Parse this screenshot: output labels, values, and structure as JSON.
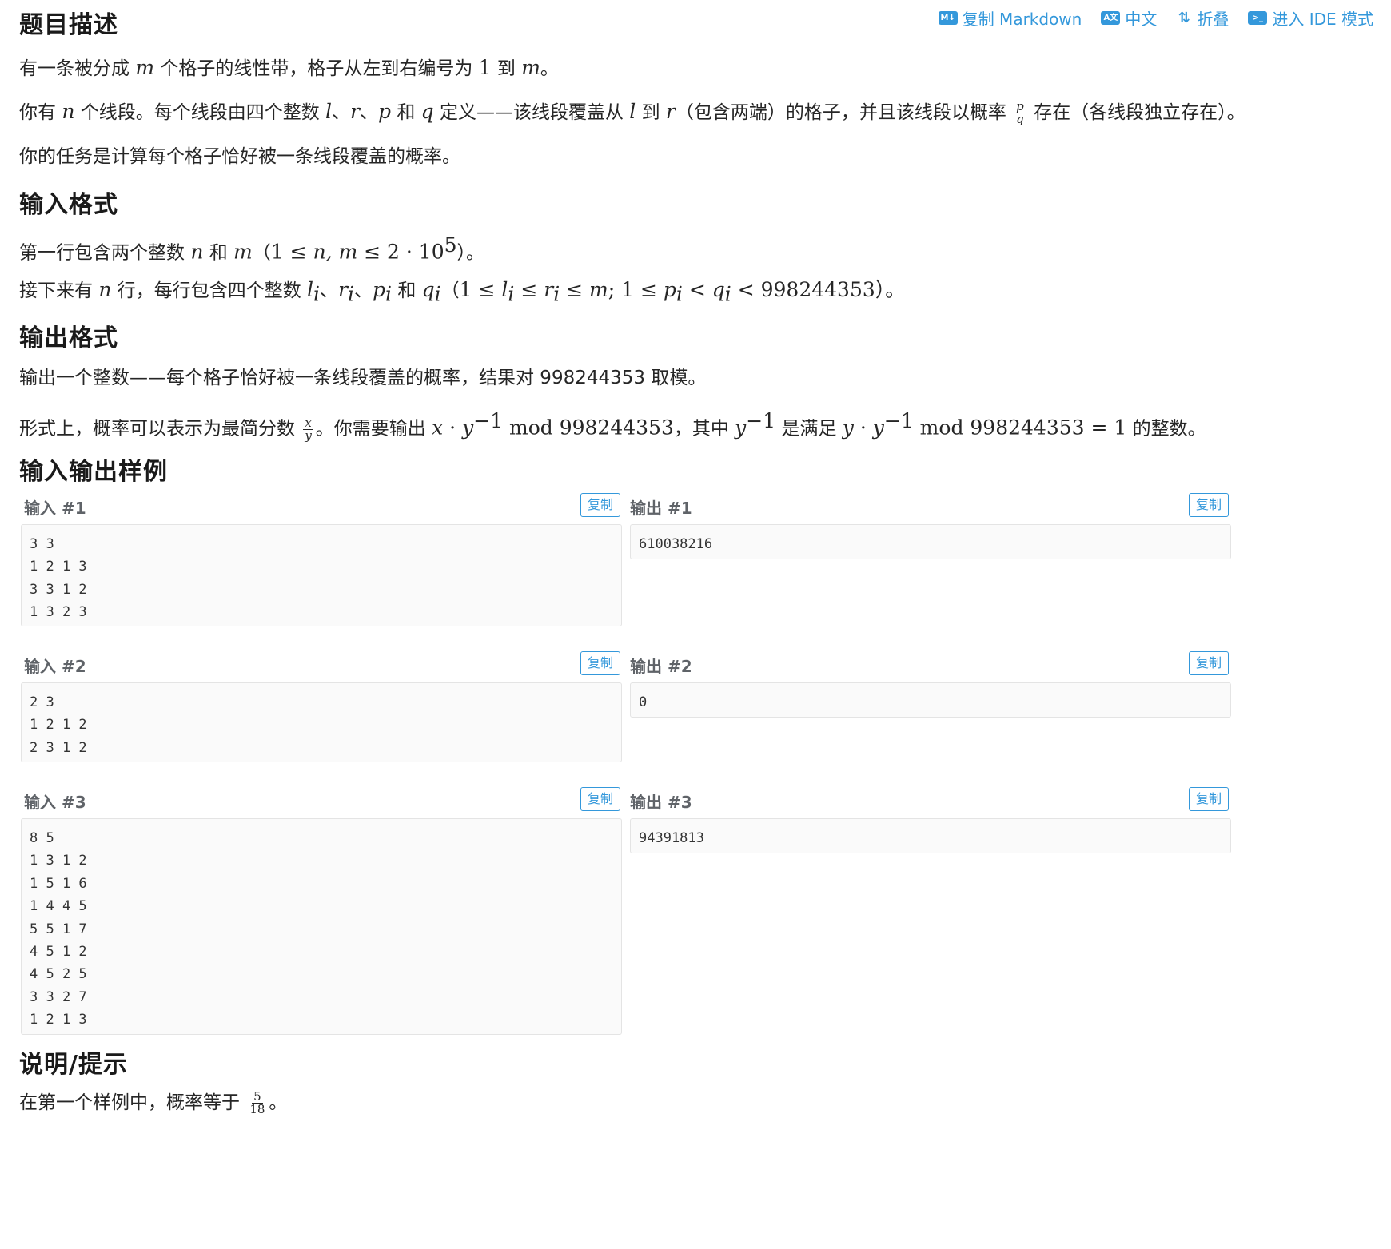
{
  "toolbar": {
    "copy_markdown": "复制 Markdown",
    "chinese": "中文",
    "fold": "折叠",
    "ide": "进入 IDE 模式",
    "md_icon": "markdown-icon",
    "lang_icon": "translate-icon",
    "fold_icon": "fold-icon",
    "ide_icon": "terminal-icon"
  },
  "headings": {
    "description": "题目描述",
    "input_format": "输入格式",
    "output_format": "输出格式",
    "samples": "输入输出样例",
    "hints": "说明/提示"
  },
  "description": {
    "p1": [
      "有一条被分成 ",
      "m",
      " 个格子的线性带，格子从左到右编号为 ",
      "1",
      " 到 ",
      "m",
      "。"
    ],
    "p2": [
      "你有 ",
      "n",
      " 个线段。每个线段由四个整数 ",
      "l",
      "、",
      "r",
      "、",
      "p",
      " 和 ",
      "q",
      " 定义——该线段覆盖从 ",
      "l",
      " 到 ",
      "r",
      "（包含两端）的格子，并且该线段以概率 ",
      "p",
      "q",
      " 存在（各线段独立存在）。"
    ],
    "p3": "你的任务是计算每个格子恰好被一条线段覆盖的概率。"
  },
  "input_format": {
    "p1": [
      "第一行包含两个整数 ",
      "n",
      " 和 ",
      "m",
      "（",
      "1 ≤ ",
      "n, m",
      " ≤ 2 · 10",
      "5",
      "）。"
    ],
    "p2": [
      "接下来有 ",
      "n",
      " 行，每行包含四个整数 ",
      "l",
      "i",
      "、",
      "r",
      "i",
      "、",
      "p",
      "i",
      " 和 ",
      "q",
      "i",
      "（",
      "1 ≤ ",
      "l",
      "i",
      " ≤ ",
      "r",
      "i",
      " ≤ ",
      "m",
      "; 1 ≤ ",
      "p",
      "i",
      " < ",
      "q",
      "i",
      " < 998244353）。"
    ]
  },
  "output_format": {
    "p1": "输出一个整数——每个格子恰好被一条线段覆盖的概率，结果对 998244353 取模。",
    "p2": [
      "形式上，概率可以表示为最简分数 ",
      "x",
      "y",
      "。你需要输出 ",
      "x",
      " · ",
      "y",
      "−1",
      " mod 998244353",
      "，其中 ",
      "y",
      "−1",
      " 是满足 ",
      "y",
      " · ",
      "y",
      "−1",
      " mod 998244353 = 1",
      " 的整数。"
    ]
  },
  "samples": [
    {
      "input_label": "输入 #1",
      "output_label": "输出 #1",
      "copy": "复制",
      "input": "3 3\n1 2 1 3\n3 3 1 2\n1 3 2 3",
      "output": "610038216"
    },
    {
      "input_label": "输入 #2",
      "output_label": "输出 #2",
      "copy": "复制",
      "input": "2 3\n1 2 1 2\n2 3 1 2",
      "output": "0"
    },
    {
      "input_label": "输入 #3",
      "output_label": "输出 #3",
      "copy": "复制",
      "input": "8 5\n1 3 1 2\n1 5 1 6\n1 4 4 5\n5 5 1 7\n4 5 1 2\n4 5 2 5\n3 3 2 7\n1 2 1 3",
      "output": "94391813"
    }
  ],
  "hints": {
    "p1": [
      "在第一个样例中，概率等于 ",
      "5",
      "18",
      "。"
    ]
  },
  "colors": {
    "accent": "#3498db",
    "code_bg": "#fafafa",
    "border": "#e4e4e4"
  }
}
